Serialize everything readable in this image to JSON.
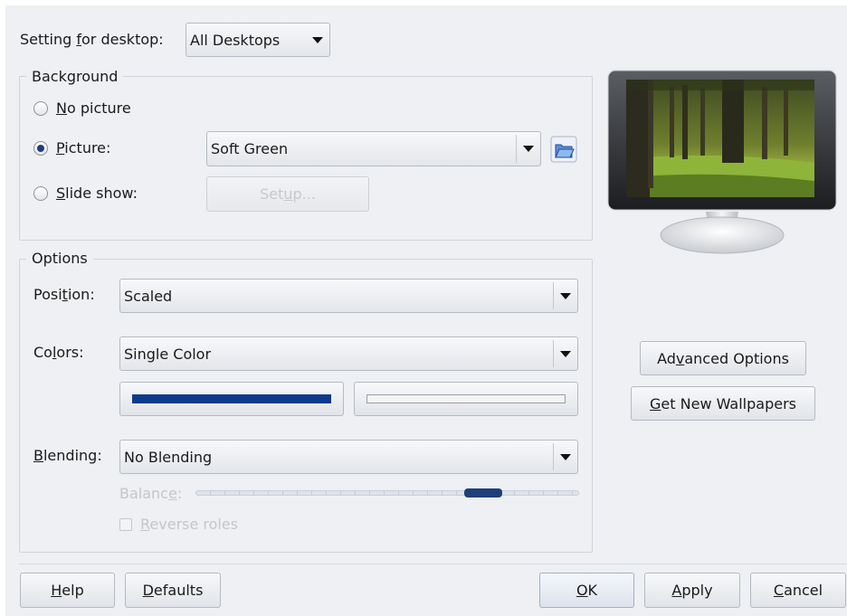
{
  "desktop_setting": {
    "label_pre": "Setting ",
    "label_u": "f",
    "label_post": "or desktop:",
    "value": "All Desktops"
  },
  "background": {
    "title": "Background",
    "no_picture": {
      "u": "N",
      "rest": "o picture",
      "checked": false
    },
    "picture": {
      "u": "P",
      "rest": "icture:",
      "checked": true,
      "value": "Soft Green"
    },
    "slide_show": {
      "u": "S",
      "rest": "lide show:",
      "checked": false
    },
    "setup_button": {
      "pre": "Set",
      "u": "u",
      "post": "p..."
    },
    "open_icon": "folder-open-icon"
  },
  "options": {
    "title": "Options",
    "position": {
      "pre": "Posi",
      "u": "t",
      "post": "ion:",
      "value": "Scaled"
    },
    "colors": {
      "pre": "Co",
      "u": "l",
      "post": "ors:",
      "value": "Single Color",
      "primary": "#0b3a8a",
      "secondary": "#f4f4f4"
    },
    "blending": {
      "pre": "",
      "u": "B",
      "post": "lending:",
      "value": "No Blending"
    },
    "balance": {
      "pre": "Balanc",
      "u": "e",
      "post": ":",
      "value": 0.75
    },
    "reverse_roles": {
      "pre": "",
      "u": "R",
      "post": "everse roles",
      "checked": false
    }
  },
  "preview": {
    "icon": "monitor-preview-icon"
  },
  "side_buttons": {
    "advanced": {
      "pre": "Ad",
      "u": "v",
      "post": "anced Options"
    },
    "get_new": {
      "pre": "",
      "u": "G",
      "post": "et New Wallpapers"
    }
  },
  "footer": {
    "help": {
      "pre": "",
      "u": "H",
      "post": "elp"
    },
    "defaults": {
      "pre": "",
      "u": "D",
      "post": "efaults"
    },
    "ok": {
      "pre": "",
      "u": "O",
      "post": "K"
    },
    "apply": {
      "pre": "",
      "u": "A",
      "post": "pply"
    },
    "cancel": {
      "pre": "",
      "u": "C",
      "post": "ancel"
    }
  }
}
